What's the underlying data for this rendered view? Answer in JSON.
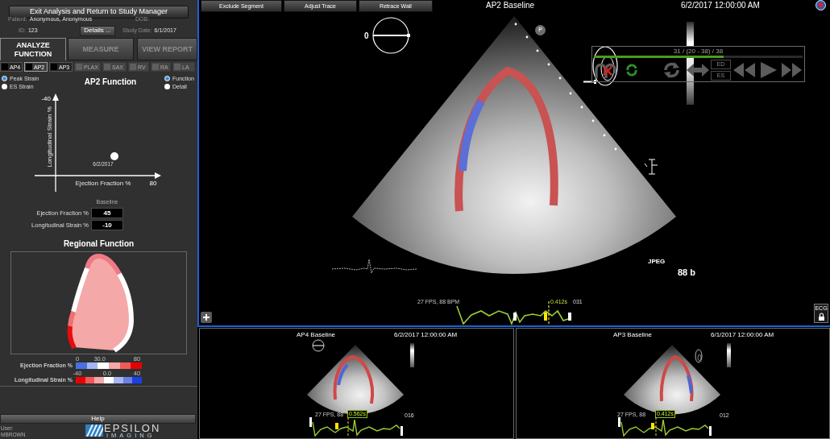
{
  "sidebar": {
    "exit_button": "Exit Analysis and Return to Study Manager",
    "patient": {
      "patient_label": "Patient:",
      "patient_name": "Anonymous, Anonymous",
      "dob_label": "DOB:",
      "id_label": "ID:",
      "id": "123",
      "details_button": "Details ...",
      "study_date_label": "Study Date:",
      "study_date": "6/1/2017"
    },
    "tabs": [
      {
        "label": "ANALYZE FUNCTION",
        "selected": true
      },
      {
        "label": "MEASURE",
        "selected": false
      },
      {
        "label": "VIEW REPORT",
        "selected": false
      }
    ],
    "views": [
      {
        "label": "AP4",
        "selected": false,
        "disabled": false
      },
      {
        "label": "AP2",
        "selected": true,
        "disabled": false
      },
      {
        "label": "AP3",
        "selected": false,
        "disabled": false
      },
      {
        "label": "PLAX",
        "selected": false,
        "disabled": true
      },
      {
        "label": "SAX",
        "selected": false,
        "disabled": true
      },
      {
        "label": "RV",
        "selected": false,
        "disabled": true
      },
      {
        "label": "RA",
        "selected": false,
        "disabled": true
      },
      {
        "label": "LA",
        "selected": false,
        "disabled": true
      }
    ],
    "strain_options": [
      {
        "label": "Peak Strain",
        "selected": true
      },
      {
        "label": "ES Strain",
        "selected": false
      }
    ],
    "display_options": [
      {
        "label": "Function",
        "selected": true
      },
      {
        "label": "Detail",
        "selected": false
      }
    ],
    "function_plot": {
      "title": "AP2 Function",
      "x_axis_label": "Ejection Fraction %",
      "x_axis_end": "80",
      "y_axis_label": "Longitudinal Strain %",
      "y_axis_end": "-40",
      "point_label": "6/2/2017"
    },
    "baseline_table": {
      "header": "Baseline",
      "rows": [
        {
          "label": "Ejection Fraction %",
          "value": "45"
        },
        {
          "label": "Longitudinal Strain %",
          "value": "-10"
        }
      ]
    },
    "regional_function": {
      "title": "Regional Function",
      "segments": [
        {
          "kind": "cavity",
          "color": "#f5a8a8"
        },
        {
          "kind": "wall",
          "color": "#ee7a86"
        },
        {
          "kind": "wall",
          "color": "#ffffff"
        },
        {
          "kind": "wall",
          "color": "#f07070"
        },
        {
          "kind": "wall",
          "color": "#e80c0c"
        },
        {
          "kind": "wall",
          "color": "#ffffff"
        }
      ],
      "legends": [
        {
          "label": "Ejection Fraction %",
          "ticks": [
            "0",
            "30.0",
            "80"
          ],
          "cells": [
            {
              "color": "#4a6fe0"
            },
            {
              "color": "#a8b6f0"
            },
            {
              "color": "#ffffff"
            },
            {
              "color": "#f4a8a8"
            },
            {
              "color": "#f05a5a"
            },
            {
              "color": "#e80000"
            }
          ]
        },
        {
          "label": "Longitudinal Strain %",
          "ticks": [
            "-40",
            "0.0",
            "40"
          ],
          "cells": [
            {
              "color": "#e80000"
            },
            {
              "color": "#f05a5a"
            },
            {
              "color": "#f4a8a8"
            },
            {
              "color": "#ffffff"
            },
            {
              "color": "#a8b6f0"
            },
            {
              "color": "#6a7fe8"
            },
            {
              "color": "#1a3fe8"
            }
          ]
        }
      ]
    },
    "help_button": "Help",
    "user": {
      "label": "User:",
      "name": "MBROWN"
    },
    "logo": {
      "name": "EPSILON",
      "tagline": "IMAGING"
    }
  },
  "main_view": {
    "toolbar": [
      "Exclude Segment",
      "Adjust Trace",
      "Retrace Wall"
    ],
    "title": "AP2 Baseline",
    "date": "6/2/2017 12:00:00 AM",
    "orientation_label": "0",
    "probe_marker": "P",
    "playback": {
      "frame_counter": "31 / (20 - 38) / 38",
      "progress": {
        "level": 0.62
      },
      "phase_buttons": [
        "ED",
        "ES"
      ]
    },
    "format_label": "JPEG",
    "heart_rate_label": "88 b",
    "ecg": {
      "rate": "27 FPS, 88 BPM",
      "time": "0.412s",
      "frame": "031"
    },
    "ecg_button": "ECG"
  },
  "thumbnails": [
    {
      "title": "AP4 Baseline",
      "date": "6/2/2017 12:00:00 AM",
      "rate": "27 FPS, 88",
      "time": "0.562s",
      "frame": "016"
    },
    {
      "title": "AP3 Baseline",
      "date": "6/1/2017 12:00:00 AM",
      "rate": "27 FPS, 88",
      "time": "0.412s",
      "frame": "012"
    }
  ]
}
